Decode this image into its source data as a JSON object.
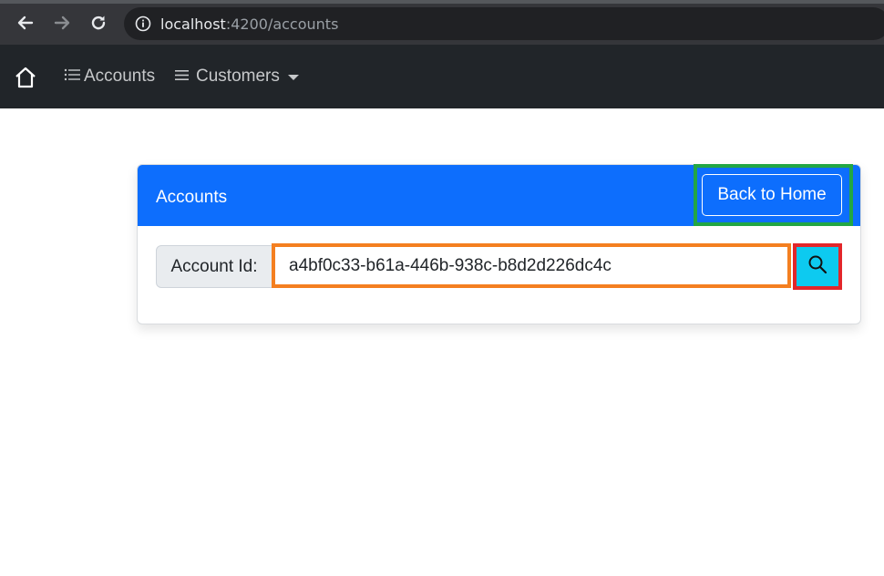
{
  "browser": {
    "url_host": "localhost",
    "url_path": ":4200/accounts"
  },
  "navbar": {
    "home_icon": "house-icon",
    "links": [
      {
        "label": "Accounts",
        "icon": "list-ol-icon"
      },
      {
        "label": "Customers",
        "icon": "list-icon"
      }
    ]
  },
  "card": {
    "title": "Accounts",
    "back_button_label": "Back to Home",
    "account_label": "Account Id:",
    "account_id_value": "a4bf0c33-b61a-446b-938c-b8d2d226dc4c",
    "search_icon": "search-icon"
  },
  "colors": {
    "primary": "#0d6efd",
    "info": "#0dcaf0",
    "navbar_bg": "#212529",
    "highlight_green": "#22a644",
    "highlight_orange": "#f47f20",
    "highlight_red": "#e3262a"
  }
}
